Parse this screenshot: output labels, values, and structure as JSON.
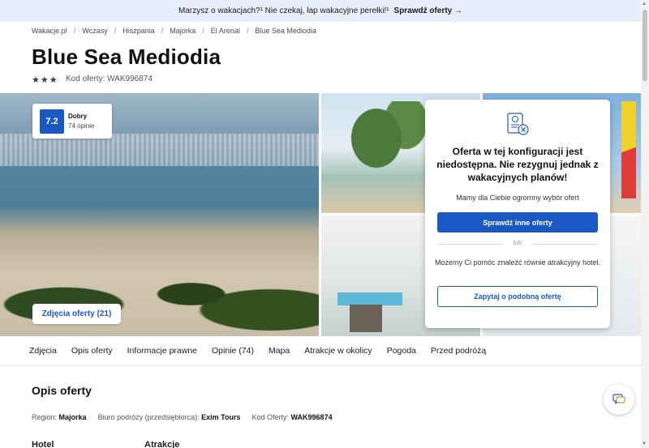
{
  "promo": {
    "text": "Marzysz o wakacjach?¹ Nie czekaj, łap wakacyjne perełki!¹",
    "cta": "Sprawdź oferty →"
  },
  "breadcrumb": [
    "Wakacje.pl",
    "Wczasy",
    "Hiszpania",
    "Majorka",
    "El Arenal",
    "Blue Sea Mediodia"
  ],
  "hotel": {
    "name": "Blue Sea Mediodia",
    "stars": 3,
    "star_glyph": "★",
    "code_label": "Kod oferty: WAK996874"
  },
  "rating": {
    "score": "7.2",
    "label": "Dobry",
    "count": "74 opinie"
  },
  "gallery": {
    "photos_button": "Zdjęcia oferty (21)"
  },
  "unavailable": {
    "icon": "document-x-icon",
    "title": "Oferta w tej konfiguracji jest niedostępna. Nie rezygnuj jednak z wakacyjnych planów!",
    "subtitle": "Mamy dla Ciebie ogromny wybór ofert",
    "primary_button": "Sprawdź inne oferty",
    "or": "lub",
    "help_text": "Możemy Ci pomóc znaleźć równie atrakcyjny hotel.",
    "secondary_button": "Zapytaj o podobną ofertę"
  },
  "tabs": [
    "Zdjęcia",
    "Opis oferty",
    "Informacje prawne",
    "Opinie (74)",
    "Mapa",
    "Atrakcje w okolicy",
    "Pogoda",
    "Przed podróżą"
  ],
  "description": {
    "title": "Opis oferty",
    "region_label": "Region:",
    "region_value": "Majorka",
    "agency_label": "Biuro podróży (przedsiębiorca):",
    "agency_value": "Exim Tours",
    "code_label": "Kod Oferty:",
    "code_value": "WAK996874",
    "col1": "Hotel",
    "col2": "Atrakcje"
  },
  "colors": {
    "brand": "#1a59c4",
    "promo_bg": "#e8eef9"
  }
}
